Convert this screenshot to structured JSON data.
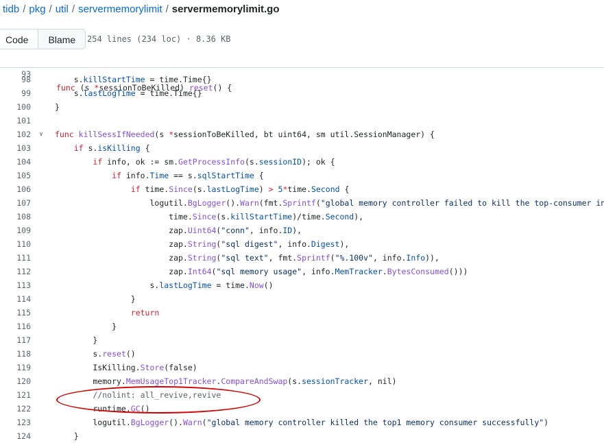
{
  "breadcrumb": {
    "repo": "tidb",
    "dirs": [
      "pkg",
      "util",
      "servermemorylimit"
    ],
    "file": "servermemorylimit.go",
    "separator": "/"
  },
  "tabs": {
    "code": "Code",
    "blame": "Blame"
  },
  "file_info": "254 lines (234 loc) · 8.36 KB",
  "colors": {
    "keyword": "#cf222e",
    "function": "#8250df",
    "string": "#0a3069",
    "member": "#0550ae",
    "comment": "#59636e",
    "annotation": "#d00000"
  },
  "sticky_line": {
    "number": "93",
    "tokens": [
      [
        "k",
        "func"
      ],
      [
        "p",
        " (s "
      ],
      [
        "k",
        "*"
      ],
      [
        "p",
        "sessionToBeKilled) "
      ],
      [
        "f",
        "reset"
      ],
      [
        "p",
        "() {"
      ]
    ]
  },
  "fold_icon": "chevron-down-icon",
  "code_lines": [
    {
      "n": "98",
      "t": [
        [
          "p",
          "    s."
        ],
        [
          "m",
          "killStartTime"
        ],
        [
          "p",
          " = time.Time{}"
        ]
      ]
    },
    {
      "n": "99",
      "t": [
        [
          "p",
          "    s."
        ],
        [
          "m",
          "lastLogTime"
        ],
        [
          "p",
          " = time.Time{}"
        ]
      ]
    },
    {
      "n": "100",
      "t": [
        [
          "p",
          "}"
        ]
      ]
    },
    {
      "n": "101",
      "t": []
    },
    {
      "n": "102",
      "fold": true,
      "t": [
        [
          "k",
          "func"
        ],
        [
          "p",
          " "
        ],
        [
          "f",
          "killSessIfNeeded"
        ],
        [
          "p",
          "(s "
        ],
        [
          "k",
          "*"
        ],
        [
          "p",
          "sessionToBeKilled, bt uint64, sm util.SessionManager) {"
        ]
      ]
    },
    {
      "n": "103",
      "t": [
        [
          "p",
          "    "
        ],
        [
          "k",
          "if"
        ],
        [
          "p",
          " s."
        ],
        [
          "m",
          "isKilling"
        ],
        [
          "p",
          " {"
        ]
      ]
    },
    {
      "n": "104",
      "t": [
        [
          "p",
          "        "
        ],
        [
          "k",
          "if"
        ],
        [
          "p",
          " info, ok := sm."
        ],
        [
          "f",
          "GetProcessInfo"
        ],
        [
          "p",
          "(s."
        ],
        [
          "m",
          "sessionID"
        ],
        [
          "p",
          "); ok {"
        ]
      ]
    },
    {
      "n": "105",
      "t": [
        [
          "p",
          "            "
        ],
        [
          "k",
          "if"
        ],
        [
          "p",
          " info."
        ],
        [
          "m",
          "Time"
        ],
        [
          "p",
          " == s."
        ],
        [
          "m",
          "sqlStartTime"
        ],
        [
          "p",
          " {"
        ]
      ]
    },
    {
      "n": "106",
      "t": [
        [
          "p",
          "                "
        ],
        [
          "k",
          "if"
        ],
        [
          "p",
          " time."
        ],
        [
          "f",
          "Since"
        ],
        [
          "p",
          "(s."
        ],
        [
          "m",
          "lastLogTime"
        ],
        [
          "p",
          ") "
        ],
        [
          "k",
          ">"
        ],
        [
          "p",
          " "
        ],
        [
          "m",
          "5"
        ],
        [
          "k",
          "*"
        ],
        [
          "p",
          "time."
        ],
        [
          "m",
          "Second"
        ],
        [
          "p",
          " {"
        ]
      ]
    },
    {
      "n": "107",
      "t": [
        [
          "p",
          "                    logutil."
        ],
        [
          "f",
          "BgLogger"
        ],
        [
          "p",
          "()."
        ],
        [
          "f",
          "Warn"
        ],
        [
          "p",
          "(fmt."
        ],
        [
          "f",
          "Sprintf"
        ],
        [
          "p",
          "("
        ],
        [
          "s",
          "\"global memory controller failed to kill the top-consumer in %ds\""
        ],
        [
          "p",
          ","
        ]
      ]
    },
    {
      "n": "108",
      "t": [
        [
          "p",
          "                        time."
        ],
        [
          "f",
          "Since"
        ],
        [
          "p",
          "(s."
        ],
        [
          "m",
          "killStartTime"
        ],
        [
          "p",
          ")/time."
        ],
        [
          "m",
          "Second"
        ],
        [
          "p",
          "),"
        ]
      ]
    },
    {
      "n": "109",
      "t": [
        [
          "p",
          "                        zap."
        ],
        [
          "f",
          "Uint64"
        ],
        [
          "p",
          "("
        ],
        [
          "s",
          "\"conn\""
        ],
        [
          "p",
          ", info."
        ],
        [
          "m",
          "ID"
        ],
        [
          "p",
          "),"
        ]
      ]
    },
    {
      "n": "110",
      "t": [
        [
          "p",
          "                        zap."
        ],
        [
          "f",
          "String"
        ],
        [
          "p",
          "("
        ],
        [
          "s",
          "\"sql digest\""
        ],
        [
          "p",
          ", info."
        ],
        [
          "m",
          "Digest"
        ],
        [
          "p",
          "),"
        ]
      ]
    },
    {
      "n": "111",
      "t": [
        [
          "p",
          "                        zap."
        ],
        [
          "f",
          "String"
        ],
        [
          "p",
          "("
        ],
        [
          "s",
          "\"sql text\""
        ],
        [
          "p",
          ", fmt."
        ],
        [
          "f",
          "Sprintf"
        ],
        [
          "p",
          "("
        ],
        [
          "s",
          "\"%.100v\""
        ],
        [
          "p",
          ", info."
        ],
        [
          "m",
          "Info"
        ],
        [
          "p",
          ")),"
        ]
      ]
    },
    {
      "n": "112",
      "t": [
        [
          "p",
          "                        zap."
        ],
        [
          "f",
          "Int64"
        ],
        [
          "p",
          "("
        ],
        [
          "s",
          "\"sql memory usage\""
        ],
        [
          "p",
          ", info."
        ],
        [
          "m",
          "MemTracker"
        ],
        [
          "p",
          "."
        ],
        [
          "f",
          "BytesConsumed"
        ],
        [
          "p",
          "()))"
        ]
      ]
    },
    {
      "n": "113",
      "t": [
        [
          "p",
          "                    s."
        ],
        [
          "m",
          "lastLogTime"
        ],
        [
          "p",
          " = time."
        ],
        [
          "f",
          "Now"
        ],
        [
          "p",
          "()"
        ]
      ]
    },
    {
      "n": "114",
      "t": [
        [
          "p",
          "                }"
        ]
      ]
    },
    {
      "n": "115",
      "t": [
        [
          "p",
          "                "
        ],
        [
          "k",
          "return"
        ]
      ]
    },
    {
      "n": "116",
      "t": [
        [
          "p",
          "            }"
        ]
      ]
    },
    {
      "n": "117",
      "t": [
        [
          "p",
          "        }"
        ]
      ]
    },
    {
      "n": "118",
      "t": [
        [
          "p",
          "        s."
        ],
        [
          "f",
          "reset"
        ],
        [
          "p",
          "()"
        ]
      ]
    },
    {
      "n": "119",
      "t": [
        [
          "p",
          "        IsKilling."
        ],
        [
          "f",
          "Store"
        ],
        [
          "p",
          "(false)"
        ]
      ]
    },
    {
      "n": "120",
      "t": [
        [
          "p",
          "        memory."
        ],
        [
          "f",
          "MemUsageTop1Tracker"
        ],
        [
          "p",
          "."
        ],
        [
          "f",
          "CompareAndSwap"
        ],
        [
          "p",
          "(s."
        ],
        [
          "m",
          "sessionTracker"
        ],
        [
          "p",
          ", nil)"
        ]
      ]
    },
    {
      "n": "121",
      "t": [
        [
          "p",
          "        "
        ],
        [
          "c",
          "//nolint: all_revive,revive"
        ]
      ]
    },
    {
      "n": "122",
      "t": [
        [
          "p",
          "        runtime."
        ],
        [
          "f",
          "GC"
        ],
        [
          "p",
          "()"
        ]
      ]
    },
    {
      "n": "123",
      "t": [
        [
          "p",
          "        logutil."
        ],
        [
          "f",
          "BgLogger"
        ],
        [
          "p",
          "()."
        ],
        [
          "f",
          "Warn"
        ],
        [
          "p",
          "("
        ],
        [
          "s",
          "\"global memory controller killed the top1 memory consumer successfully\""
        ],
        [
          "p",
          ")"
        ]
      ]
    },
    {
      "n": "124",
      "t": [
        [
          "p",
          "    }"
        ]
      ]
    }
  ]
}
